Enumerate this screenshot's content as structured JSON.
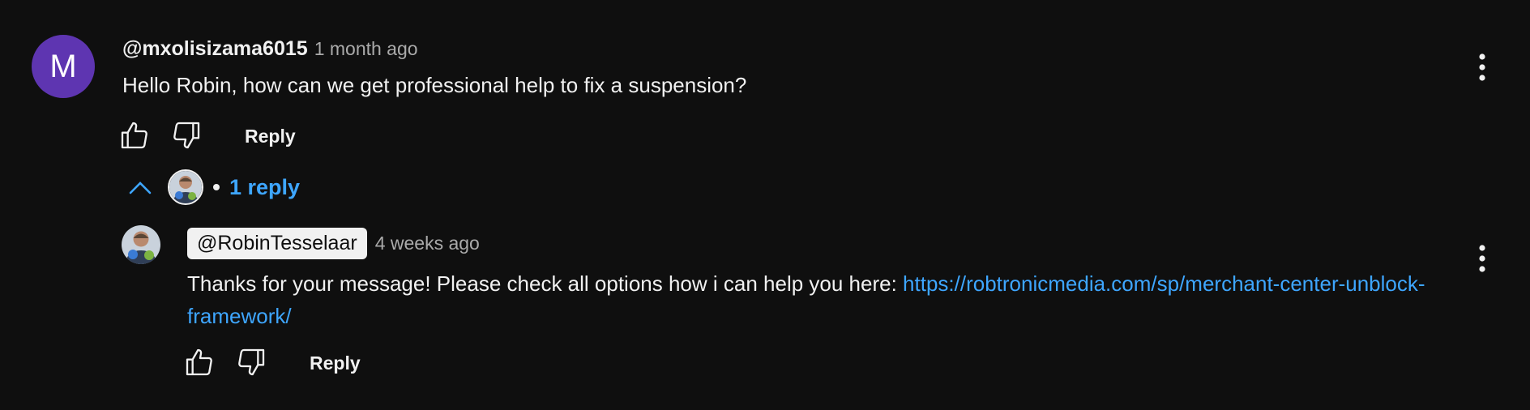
{
  "comment": {
    "avatar_letter": "M",
    "avatar_color": "#5e35b1",
    "author": "@mxolisizama6015",
    "time": "1 month ago",
    "text": "Hello Robin, how can we get professional help to fix a suspension?",
    "reply_label": "Reply"
  },
  "replies_toggle": {
    "label": "1 reply",
    "icon": "chevron-up-icon"
  },
  "reply": {
    "author": "@RobinTesselaar",
    "time": "4 weeks ago",
    "text": "Thanks for your message! Please check all options how i can help you here: ",
    "link": "https://robtronicmedia.com/sp/merchant-center-unblock-framework/",
    "reply_label": "Reply"
  },
  "icons": {
    "like": "thumbs-up-icon",
    "dislike": "thumbs-down-icon",
    "menu": "more-vertical-icon"
  },
  "colors": {
    "background": "#0f0f0f",
    "text": "#f1f1f1",
    "muted": "#aaaaaa",
    "link": "#3ea6ff"
  }
}
